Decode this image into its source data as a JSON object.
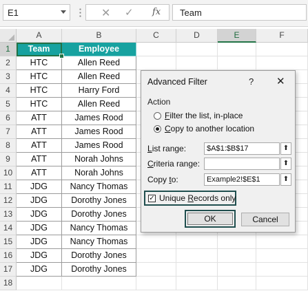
{
  "formula_bar": {
    "name_box": "E1",
    "cancel_icon": "✕",
    "enter_icon": "✓",
    "fx_label": "fx",
    "content": "Team"
  },
  "columns": [
    "A",
    "B",
    "C",
    "D",
    "E",
    "F"
  ],
  "rows": [
    "1",
    "2",
    "3",
    "4",
    "5",
    "6",
    "7",
    "8",
    "9",
    "10",
    "11",
    "12",
    "13",
    "14",
    "15",
    "16",
    "17",
    "18"
  ],
  "table": {
    "headers": [
      "Team",
      "Employee"
    ],
    "rows": [
      [
        "HTC",
        "Allen Reed"
      ],
      [
        "HTC",
        "Allen Reed"
      ],
      [
        "HTC",
        "Harry Ford"
      ],
      [
        "HTC",
        "Allen Reed"
      ],
      [
        "ATT",
        "James Rood"
      ],
      [
        "ATT",
        "James Rood"
      ],
      [
        "ATT",
        "James Rood"
      ],
      [
        "ATT",
        "Norah Johns"
      ],
      [
        "ATT",
        "Norah Johns"
      ],
      [
        "JDG",
        "Nancy Thomas"
      ],
      [
        "JDG",
        "Dorothy Jones"
      ],
      [
        "JDG",
        "Dorothy Jones"
      ],
      [
        "JDG",
        "Nancy Thomas"
      ],
      [
        "JDG",
        "Nancy Thomas"
      ],
      [
        "JDG",
        "Dorothy Jones"
      ],
      [
        "JDG",
        "Dorothy Jones"
      ]
    ]
  },
  "dialog": {
    "title": "Advanced Filter",
    "help": "?",
    "close": "✕",
    "action_label": "Action",
    "option1": {
      "accel": "F",
      "rest": "ilter the list, in-place"
    },
    "option2": {
      "accel": "C",
      "rest": "opy to another location"
    },
    "list_range": {
      "accel": "L",
      "rest": "ist range:",
      "value": "$A$1:$B$17"
    },
    "criteria_range": {
      "accel": "C",
      "rest": "riteria range:",
      "value": ""
    },
    "copy_to": {
      "pre": "Copy ",
      "accel": "t",
      "rest": "o:",
      "value": "Example2!$E$1"
    },
    "collapse_icon": "⬆",
    "checkbox_mark": "✓",
    "unique": {
      "accel": "R",
      "pre": "Unique ",
      "rest": "ecords only"
    },
    "ok_label": "OK",
    "cancel_label": "Cancel"
  },
  "colors": {
    "header_fill": "#17a2a0",
    "selection": "#217346",
    "highlight_outline": "#1f4e4e"
  }
}
